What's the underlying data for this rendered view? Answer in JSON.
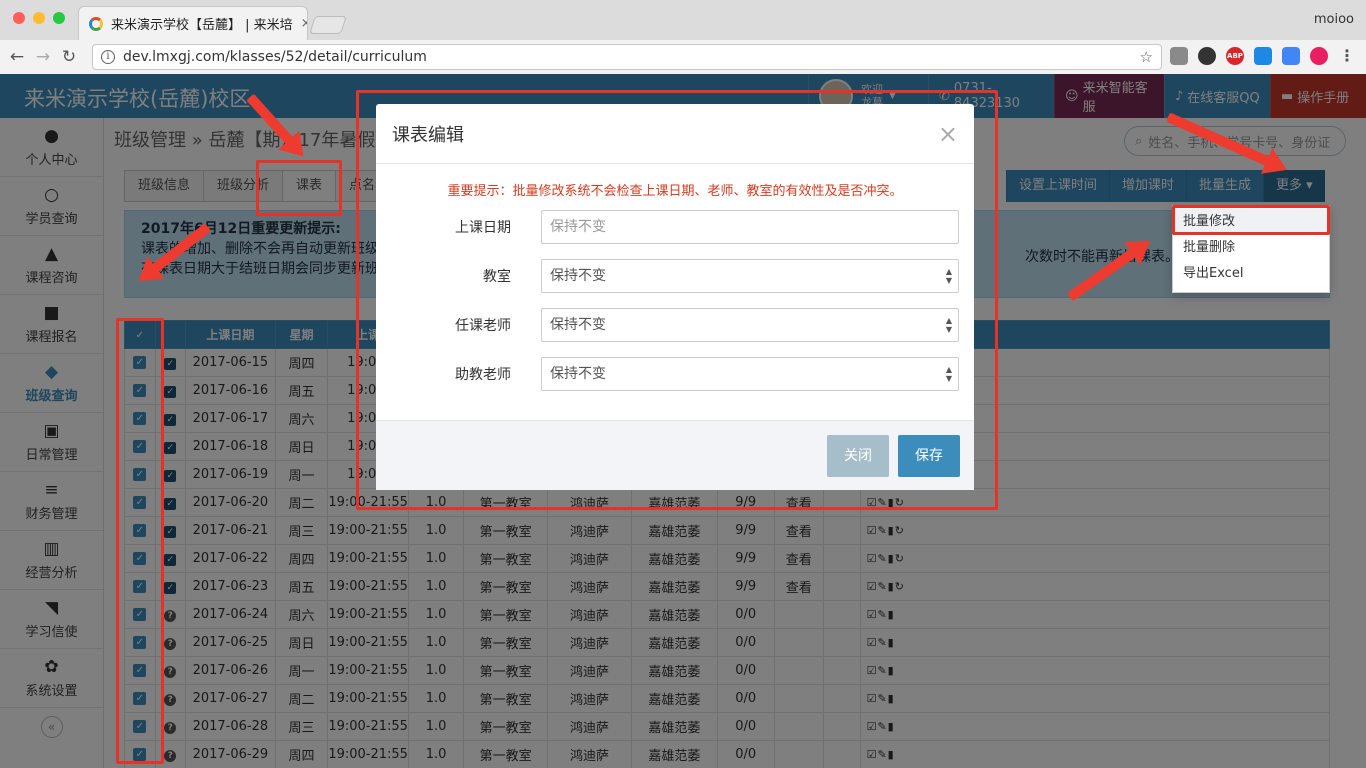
{
  "browser": {
    "tab_title": "来米演示学校【岳麓】 | 来米培",
    "tab_close": "×",
    "url": "dev.lmxgj.com/klasses/52/detail/curriculum",
    "user": "moioo",
    "ext_abp": "ABP"
  },
  "app": {
    "title": "来米演示学校(岳麓)校区",
    "welcome": "欢迎",
    "username": "龙慕",
    "phone": "0731-84323130",
    "service": "来米智能客服",
    "qq": "在线客服QQ",
    "manual": "操作手册"
  },
  "sidebar": {
    "items": [
      {
        "label": "个人中心",
        "icon": "user-icon"
      },
      {
        "label": "学员查询",
        "icon": "search-icon"
      },
      {
        "label": "课程咨询",
        "icon": "graduation-cap-icon"
      },
      {
        "label": "课程报名",
        "icon": "cart-icon"
      },
      {
        "label": "班级查询",
        "icon": "cubes-icon"
      },
      {
        "label": "日常管理",
        "icon": "slideshare-icon"
      },
      {
        "label": "财务管理",
        "icon": "bars-icon"
      },
      {
        "label": "经营分析",
        "icon": "bar-chart-icon"
      },
      {
        "label": "学习信使",
        "icon": "twitter-icon"
      },
      {
        "label": "系统设置",
        "icon": "cogs-icon"
      }
    ],
    "collapse": "«"
  },
  "content": {
    "breadcrumb": "班级管理 » 岳麓【期】17年暑假区",
    "search_placeholder": "姓名、手机、学号卡号、身份证",
    "tabs": [
      "班级信息",
      "班级分析",
      "课表",
      "点名表"
    ],
    "actions": [
      "设置上课时间",
      "增加课时",
      "批量生成",
      "更多 ▾"
    ],
    "notice_title": "2017年6月12日重要更新提示:",
    "notice_line1": "课表的增加、删除不会再自动更新班级",
    "notice_line2": "有课表日期大于结班日期会同步更新班",
    "notice_right": "次数时不能再新增课表。",
    "notice_right2": "课表"
  },
  "table": {
    "headers": [
      "上课日期",
      "星期",
      "上课"
    ],
    "rows": [
      {
        "date": "2017-06-15",
        "week": "周四",
        "time": "19:00-",
        "status": "check"
      },
      {
        "date": "2017-06-16",
        "week": "周五",
        "time": "19:00-",
        "status": "check"
      },
      {
        "date": "2017-06-17",
        "week": "周六",
        "time": "19:00-",
        "status": "check"
      },
      {
        "date": "2017-06-18",
        "week": "周日",
        "time": "19:00-",
        "status": "check"
      },
      {
        "date": "2017-06-19",
        "week": "周一",
        "time": "19:00-",
        "status": "check"
      },
      {
        "date": "2017-06-20",
        "week": "周二",
        "time": "19:00-21:55",
        "hours": "1.0",
        "room": "第一教室",
        "teacher": "鸿迪萨",
        "assistant": "嘉雄范萎",
        "count": "9/9",
        "view": "查看",
        "status": "check"
      },
      {
        "date": "2017-06-21",
        "week": "周三",
        "time": "19:00-21:55",
        "hours": "1.0",
        "room": "第一教室",
        "teacher": "鸿迪萨",
        "assistant": "嘉雄范萎",
        "count": "9/9",
        "view": "查看",
        "status": "check"
      },
      {
        "date": "2017-06-22",
        "week": "周四",
        "time": "19:00-21:55",
        "hours": "1.0",
        "room": "第一教室",
        "teacher": "鸿迪萨",
        "assistant": "嘉雄范萎",
        "count": "9/9",
        "view": "查看",
        "status": "check"
      },
      {
        "date": "2017-06-23",
        "week": "周五",
        "time": "19:00-21:55",
        "hours": "1.0",
        "room": "第一教室",
        "teacher": "鸿迪萨",
        "assistant": "嘉雄范萎",
        "count": "9/9",
        "view": "查看",
        "status": "check"
      },
      {
        "date": "2017-06-24",
        "week": "周六",
        "time": "19:00-21:55",
        "hours": "1.0",
        "room": "第一教室",
        "teacher": "鸿迪萨",
        "assistant": "嘉雄范萎",
        "count": "0/0",
        "view": "",
        "status": "question"
      },
      {
        "date": "2017-06-25",
        "week": "周日",
        "time": "19:00-21:55",
        "hours": "1.0",
        "room": "第一教室",
        "teacher": "鸿迪萨",
        "assistant": "嘉雄范萎",
        "count": "0/0",
        "view": "",
        "status": "question"
      },
      {
        "date": "2017-06-26",
        "week": "周一",
        "time": "19:00-21:55",
        "hours": "1.0",
        "room": "第一教室",
        "teacher": "鸿迪萨",
        "assistant": "嘉雄范萎",
        "count": "0/0",
        "view": "",
        "status": "question"
      },
      {
        "date": "2017-06-27",
        "week": "周二",
        "time": "19:00-21:55",
        "hours": "1.0",
        "room": "第一教室",
        "teacher": "鸿迪萨",
        "assistant": "嘉雄范萎",
        "count": "0/0",
        "view": "",
        "status": "question"
      },
      {
        "date": "2017-06-28",
        "week": "周三",
        "time": "19:00-21:55",
        "hours": "1.0",
        "room": "第一教室",
        "teacher": "鸿迪萨",
        "assistant": "嘉雄范萎",
        "count": "0/0",
        "view": "",
        "status": "question"
      },
      {
        "date": "2017-06-29",
        "week": "周四",
        "time": "19:00-21:55",
        "hours": "1.0",
        "room": "第一教室",
        "teacher": "鸿迪萨",
        "assistant": "嘉雄范萎",
        "count": "0/0",
        "view": "",
        "status": "question"
      }
    ]
  },
  "modal": {
    "title": "课表编辑",
    "close_x": "×",
    "warning": "重要提示：批量修改系统不会检查上课日期、老师、教室的有效性及是否冲突。",
    "date_label": "上课日期",
    "date_placeholder": "保持不变",
    "room_label": "教室",
    "room_value": "保持不变",
    "teacher_label": "任课老师",
    "teacher_value": "保持不变",
    "assistant_label": "助教老师",
    "assistant_value": "保持不变",
    "close_button": "关闭",
    "save_button": "保存"
  },
  "dropdown": {
    "items": [
      "批量修改",
      "批量删除",
      "导出Excel"
    ]
  },
  "colors": {
    "primary": "#3c8dbc",
    "annotation": "#e5332a",
    "warning_text": "#d73a1e"
  }
}
